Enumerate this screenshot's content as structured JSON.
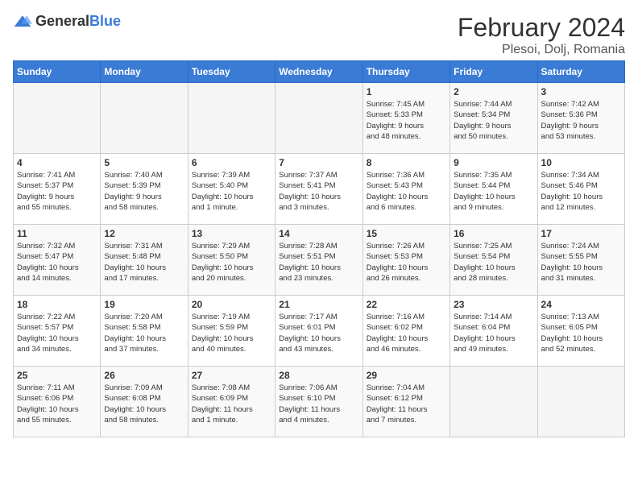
{
  "logo": {
    "text_general": "General",
    "text_blue": "Blue"
  },
  "header": {
    "title": "February 2024",
    "subtitle": "Plesoi, Dolj, Romania"
  },
  "days_of_week": [
    "Sunday",
    "Monday",
    "Tuesday",
    "Wednesday",
    "Thursday",
    "Friday",
    "Saturday"
  ],
  "weeks": [
    [
      {
        "day": "",
        "info": ""
      },
      {
        "day": "",
        "info": ""
      },
      {
        "day": "",
        "info": ""
      },
      {
        "day": "",
        "info": ""
      },
      {
        "day": "1",
        "info": "Sunrise: 7:45 AM\nSunset: 5:33 PM\nDaylight: 9 hours\nand 48 minutes."
      },
      {
        "day": "2",
        "info": "Sunrise: 7:44 AM\nSunset: 5:34 PM\nDaylight: 9 hours\nand 50 minutes."
      },
      {
        "day": "3",
        "info": "Sunrise: 7:42 AM\nSunset: 5:36 PM\nDaylight: 9 hours\nand 53 minutes."
      }
    ],
    [
      {
        "day": "4",
        "info": "Sunrise: 7:41 AM\nSunset: 5:37 PM\nDaylight: 9 hours\nand 55 minutes."
      },
      {
        "day": "5",
        "info": "Sunrise: 7:40 AM\nSunset: 5:39 PM\nDaylight: 9 hours\nand 58 minutes."
      },
      {
        "day": "6",
        "info": "Sunrise: 7:39 AM\nSunset: 5:40 PM\nDaylight: 10 hours\nand 1 minute."
      },
      {
        "day": "7",
        "info": "Sunrise: 7:37 AM\nSunset: 5:41 PM\nDaylight: 10 hours\nand 3 minutes."
      },
      {
        "day": "8",
        "info": "Sunrise: 7:36 AM\nSunset: 5:43 PM\nDaylight: 10 hours\nand 6 minutes."
      },
      {
        "day": "9",
        "info": "Sunrise: 7:35 AM\nSunset: 5:44 PM\nDaylight: 10 hours\nand 9 minutes."
      },
      {
        "day": "10",
        "info": "Sunrise: 7:34 AM\nSunset: 5:46 PM\nDaylight: 10 hours\nand 12 minutes."
      }
    ],
    [
      {
        "day": "11",
        "info": "Sunrise: 7:32 AM\nSunset: 5:47 PM\nDaylight: 10 hours\nand 14 minutes."
      },
      {
        "day": "12",
        "info": "Sunrise: 7:31 AM\nSunset: 5:48 PM\nDaylight: 10 hours\nand 17 minutes."
      },
      {
        "day": "13",
        "info": "Sunrise: 7:29 AM\nSunset: 5:50 PM\nDaylight: 10 hours\nand 20 minutes."
      },
      {
        "day": "14",
        "info": "Sunrise: 7:28 AM\nSunset: 5:51 PM\nDaylight: 10 hours\nand 23 minutes."
      },
      {
        "day": "15",
        "info": "Sunrise: 7:26 AM\nSunset: 5:53 PM\nDaylight: 10 hours\nand 26 minutes."
      },
      {
        "day": "16",
        "info": "Sunrise: 7:25 AM\nSunset: 5:54 PM\nDaylight: 10 hours\nand 28 minutes."
      },
      {
        "day": "17",
        "info": "Sunrise: 7:24 AM\nSunset: 5:55 PM\nDaylight: 10 hours\nand 31 minutes."
      }
    ],
    [
      {
        "day": "18",
        "info": "Sunrise: 7:22 AM\nSunset: 5:57 PM\nDaylight: 10 hours\nand 34 minutes."
      },
      {
        "day": "19",
        "info": "Sunrise: 7:20 AM\nSunset: 5:58 PM\nDaylight: 10 hours\nand 37 minutes."
      },
      {
        "day": "20",
        "info": "Sunrise: 7:19 AM\nSunset: 5:59 PM\nDaylight: 10 hours\nand 40 minutes."
      },
      {
        "day": "21",
        "info": "Sunrise: 7:17 AM\nSunset: 6:01 PM\nDaylight: 10 hours\nand 43 minutes."
      },
      {
        "day": "22",
        "info": "Sunrise: 7:16 AM\nSunset: 6:02 PM\nDaylight: 10 hours\nand 46 minutes."
      },
      {
        "day": "23",
        "info": "Sunrise: 7:14 AM\nSunset: 6:04 PM\nDaylight: 10 hours\nand 49 minutes."
      },
      {
        "day": "24",
        "info": "Sunrise: 7:13 AM\nSunset: 6:05 PM\nDaylight: 10 hours\nand 52 minutes."
      }
    ],
    [
      {
        "day": "25",
        "info": "Sunrise: 7:11 AM\nSunset: 6:06 PM\nDaylight: 10 hours\nand 55 minutes."
      },
      {
        "day": "26",
        "info": "Sunrise: 7:09 AM\nSunset: 6:08 PM\nDaylight: 10 hours\nand 58 minutes."
      },
      {
        "day": "27",
        "info": "Sunrise: 7:08 AM\nSunset: 6:09 PM\nDaylight: 11 hours\nand 1 minute."
      },
      {
        "day": "28",
        "info": "Sunrise: 7:06 AM\nSunset: 6:10 PM\nDaylight: 11 hours\nand 4 minutes."
      },
      {
        "day": "29",
        "info": "Sunrise: 7:04 AM\nSunset: 6:12 PM\nDaylight: 11 hours\nand 7 minutes."
      },
      {
        "day": "",
        "info": ""
      },
      {
        "day": "",
        "info": ""
      }
    ]
  ]
}
